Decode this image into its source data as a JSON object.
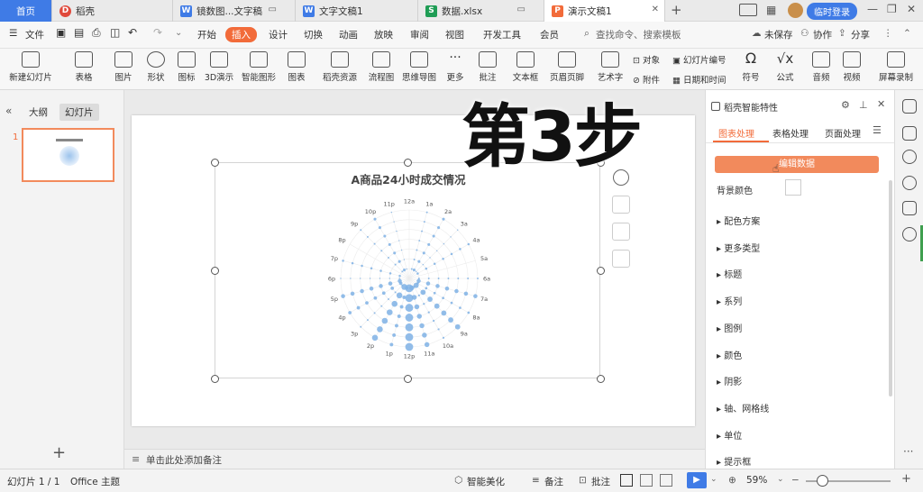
{
  "tabs": {
    "home": "首页",
    "items": [
      {
        "label": "稻壳",
        "icon": "daoke-icon",
        "color": "#e0493b"
      },
      {
        "label": "镜数图...文字稿",
        "icon": "wps-writer-icon",
        "color": "#3f7be6"
      },
      {
        "label": "文字文稿1",
        "icon": "wps-writer-icon",
        "color": "#3f7be6"
      },
      {
        "label": "数据.xlsx",
        "icon": "wps-sheet-icon",
        "color": "#1f9d55"
      },
      {
        "label": "演示文稿1",
        "icon": "wps-presentation-icon",
        "color": "#f26b3a"
      }
    ],
    "login_button": "临时登录"
  },
  "menu": {
    "file": "文件",
    "items": [
      "开始",
      "插入",
      "设计",
      "切换",
      "动画",
      "放映",
      "审阅",
      "视图",
      "开发工具",
      "会员"
    ],
    "active": "插入",
    "search_placeholder": "查找命令、搜索模板",
    "unsaved": "未保存",
    "collab": "协作",
    "share": "分享"
  },
  "ribbon": {
    "buttons": [
      "新建幻灯片",
      "表格",
      "图片",
      "形状",
      "图标",
      "3D演示",
      "智能图形",
      "图表",
      "稻壳资源",
      "流程图",
      "思维导图",
      "更多",
      "批注",
      "文本框",
      "页眉页脚",
      "艺术字",
      "符号",
      "公式",
      "音频",
      "视频",
      "屏幕录制"
    ],
    "small": [
      "对象",
      "附件",
      "幻灯片编号",
      "日期和时间"
    ]
  },
  "left_panel": {
    "tabs": [
      "大纲",
      "幻灯片"
    ],
    "slide_number": "1",
    "add": "+"
  },
  "slide": {
    "chart_title": "A商品24小时成交情况",
    "notes_placeholder": "单击此处添加备注"
  },
  "chart_data": {
    "type": "scatter",
    "subtype": "polar-bubble",
    "title": "A商品24小时成交情况",
    "angle_labels": [
      "12a",
      "1a",
      "2a",
      "3a",
      "4a",
      "5a",
      "6a",
      "7a",
      "8a",
      "9a",
      "10a",
      "11a",
      "12p",
      "1p",
      "2p",
      "3p",
      "4p",
      "5p",
      "6p",
      "7p",
      "8p",
      "9p",
      "10p",
      "11p"
    ],
    "bubble_color": "#7fb2e5",
    "radial_rings": 7
  },
  "overlay_text": "第3步",
  "right_panel": {
    "title": "稻壳智能特性",
    "tabs": [
      "图表处理",
      "表格处理",
      "页面处理"
    ],
    "active_tab": "图表处理",
    "edit_data": "编辑数据",
    "bg_color": "背景颜色",
    "sections": [
      "配色方案",
      "更多类型",
      "标题",
      "系列",
      "图例",
      "颜色",
      "阴影",
      "轴、网格线",
      "单位",
      "提示框"
    ]
  },
  "status": {
    "slide_info": "幻灯片 1 / 1",
    "theme": "Office 主题",
    "beautify": "智能美化",
    "notes": "备注",
    "comments": "批注",
    "zoom": "59%"
  },
  "colors": {
    "accent": "#f26b3a",
    "brand_blue": "#3f7be6",
    "edit_button": "#f28a5c"
  }
}
